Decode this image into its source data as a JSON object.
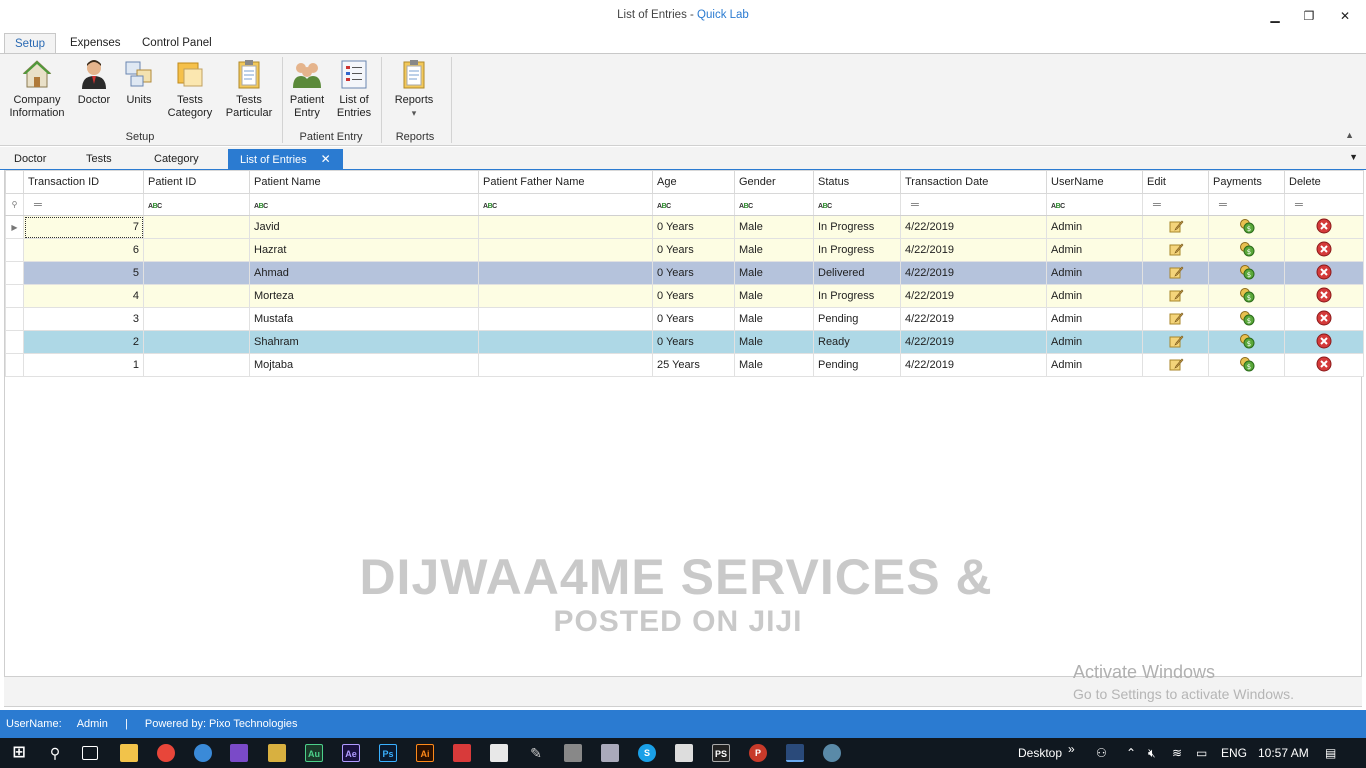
{
  "window": {
    "title_prefix": "List of Entries - ",
    "title_app": "Quick Lab",
    "minimize": "▁",
    "restore": "❐",
    "close": "✕"
  },
  "ribbon_tabs": [
    "Setup",
    "Expenses",
    "Control Panel"
  ],
  "ribbon": {
    "groups": [
      {
        "label": "Setup",
        "buttons": [
          {
            "line1": "Company",
            "line2": "Information",
            "icon": "house-icon"
          },
          {
            "line1": "Doctor",
            "line2": "",
            "icon": "doctor-icon"
          },
          {
            "line1": "Units",
            "line2": "",
            "icon": "units-icon"
          },
          {
            "line1": "Tests",
            "line2": "Category",
            "icon": "folder-icon"
          },
          {
            "line1": "Tests",
            "line2": "Particular",
            "icon": "clipboard-icon"
          }
        ]
      },
      {
        "label": "Patient Entry",
        "buttons": [
          {
            "line1": "Patient",
            "line2": "Entry",
            "icon": "patients-icon"
          },
          {
            "line1": "List of",
            "line2": "Entries",
            "icon": "list-icon"
          }
        ]
      },
      {
        "label": "Reports",
        "buttons": [
          {
            "line1": "Reports",
            "line2": "▾",
            "icon": "report-clipboard-icon"
          }
        ]
      }
    ]
  },
  "doc_tabs": [
    "Doctor",
    "Tests",
    "Category",
    "List of Entries"
  ],
  "doc_tab_close": "✕",
  "grid": {
    "columns": [
      "Transaction ID",
      "Patient ID",
      "Patient Name",
      "Patient Father Name",
      "Age",
      "Gender",
      "Status",
      "Transaction Date",
      "UserName",
      "Edit",
      "Payments",
      "Delete"
    ],
    "rows": [
      {
        "id": "7",
        "patient_id": "",
        "name": "Javid",
        "father": "",
        "age": "0 Years",
        "gender": "Male",
        "status": "In Progress",
        "date": "4/22/2019",
        "user": "Admin"
      },
      {
        "id": "6",
        "patient_id": "",
        "name": "Hazrat",
        "father": "",
        "age": "0 Years",
        "gender": "Male",
        "status": "In Progress",
        "date": "4/22/2019",
        "user": "Admin"
      },
      {
        "id": "5",
        "patient_id": "",
        "name": "Ahmad",
        "father": "",
        "age": "0 Years",
        "gender": "Male",
        "status": "Delivered",
        "date": "4/22/2019",
        "user": "Admin"
      },
      {
        "id": "4",
        "patient_id": "",
        "name": "Morteza",
        "father": "",
        "age": "0 Years",
        "gender": "Male",
        "status": "In Progress",
        "date": "4/22/2019",
        "user": "Admin"
      },
      {
        "id": "3",
        "patient_id": "",
        "name": "Mustafa",
        "father": "",
        "age": "0 Years",
        "gender": "Male",
        "status": "Pending",
        "date": "4/22/2019",
        "user": "Admin"
      },
      {
        "id": "2",
        "patient_id": "",
        "name": "Shahram",
        "father": "",
        "age": "0 Years",
        "gender": "Male",
        "status": "Ready",
        "date": "4/22/2019",
        "user": "Admin"
      },
      {
        "id": "1",
        "patient_id": "",
        "name": "Mojtaba",
        "father": "",
        "age": "25 Years",
        "gender": "Male",
        "status": "Pending",
        "date": "4/22/2019",
        "user": "Admin"
      }
    ],
    "status_colors": {
      "In Progress": "#fdfde3",
      "Delivered": "#b5c3dc",
      "Ready": "#aed8e6",
      "Pending": "#ffffff"
    }
  },
  "watermark": {
    "line1": "DIJWAA4ME SERVICES &",
    "line2": "POSTED ON JIJI",
    "activate_title": "Activate Windows",
    "activate_sub": "Go to Settings to activate Windows."
  },
  "statusbar": {
    "user_label": "UserName:",
    "user_value": "Admin",
    "separator": "|",
    "powered": "Powered by: Pixo Technologies"
  },
  "taskbar": {
    "desktop": "Desktop",
    "chevrons": "»",
    "lang": "ENG",
    "time": "10:57 AM"
  },
  "colors": {
    "accent": "#2b7bd1",
    "taskbar": "#101820"
  }
}
